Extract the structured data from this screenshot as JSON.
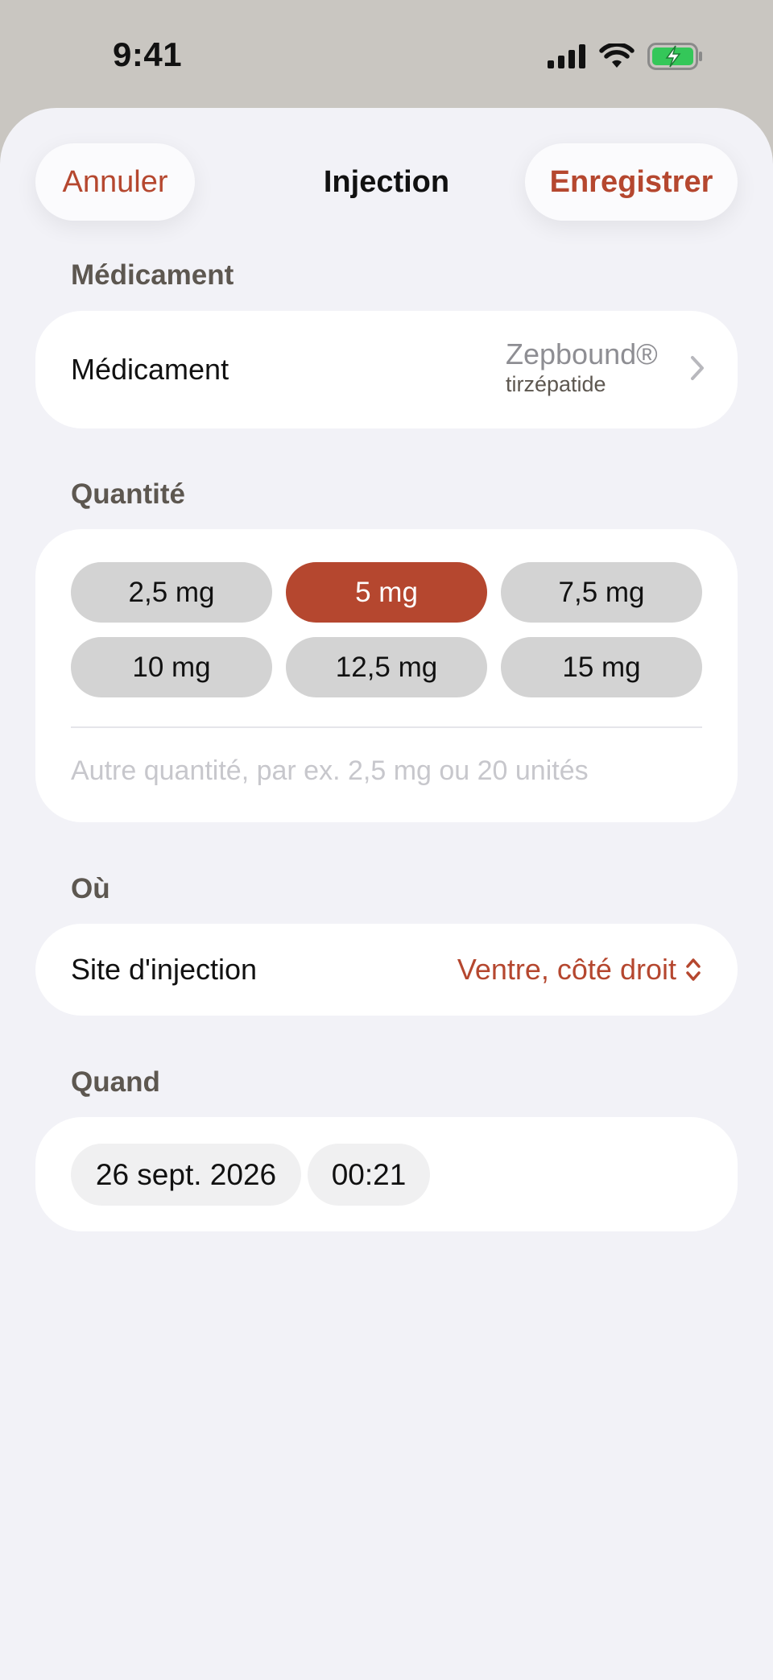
{
  "status_bar": {
    "time": "9:41",
    "icons": [
      "cellular-signal-icon",
      "wifi-icon",
      "battery-charging-icon"
    ],
    "battery_color": "#34c759"
  },
  "nav": {
    "cancel_label": "Annuler",
    "title": "Injection",
    "save_label": "Enregistrer"
  },
  "sections": {
    "medication": {
      "header": "Médicament",
      "row_label": "Médicament",
      "value_name": "Zepbound®",
      "value_generic": "tirzépatide"
    },
    "quantity": {
      "header": "Quantité",
      "options": [
        "2,5 mg",
        "5 mg",
        "7,5 mg",
        "10 mg",
        "12,5 mg",
        "15 mg"
      ],
      "selected": "5 mg",
      "custom_value": "",
      "custom_placeholder": "Autre quantité, par ex. 2,5 mg ou 20 unités"
    },
    "where": {
      "header": "Où",
      "row_label": "Site d'injection",
      "value": "Ventre, côté droit"
    },
    "when": {
      "header": "Quand",
      "date": "26 sept. 2026",
      "time": "00:21"
    }
  },
  "colors": {
    "accent": "#b5472f",
    "background": "#f2f2f7",
    "card": "#ffffff",
    "chip": "#d3d3d3",
    "section_header": "#5d5750"
  }
}
